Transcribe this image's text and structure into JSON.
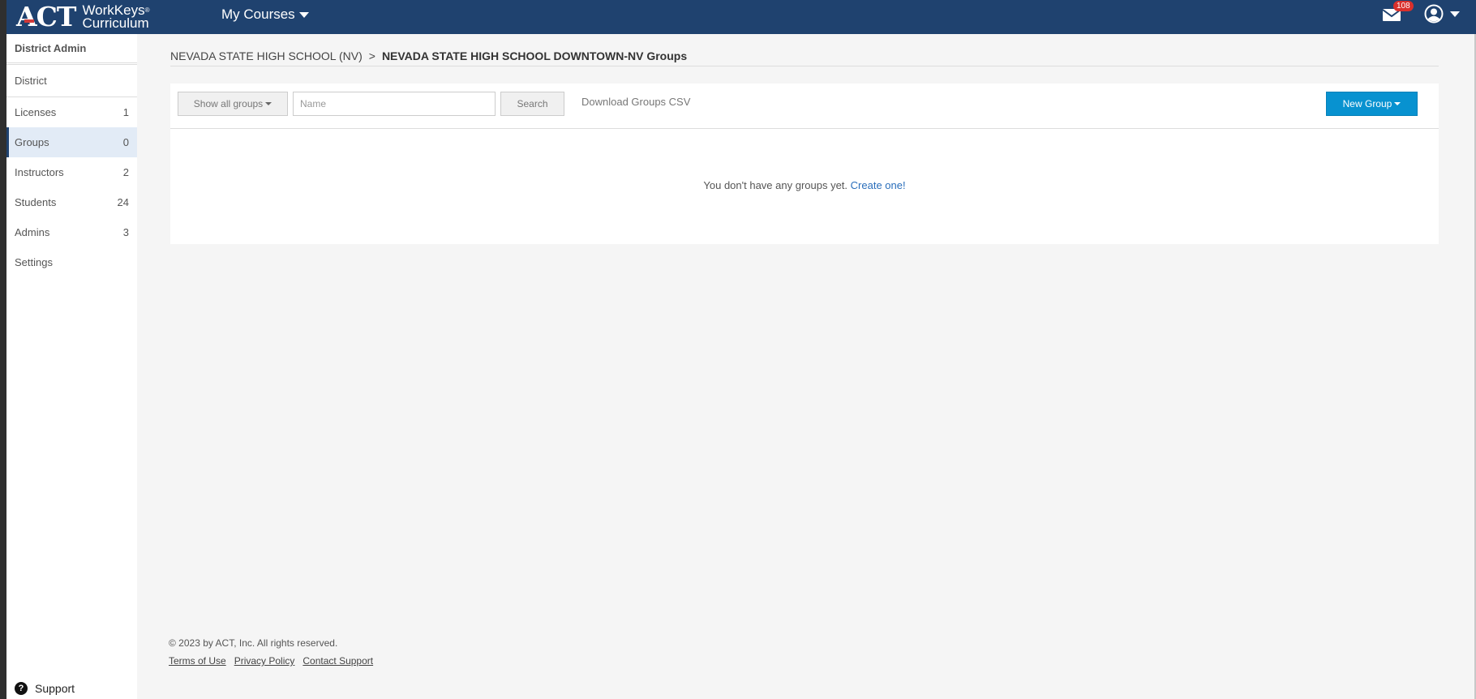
{
  "header": {
    "logo": {
      "brand": "ACT",
      "product_line1": "WorkKeys",
      "product_line2": "Curriculum"
    },
    "menu_label": "My Courses",
    "mail_badge": "108",
    "colors": {
      "nav_bg": "#1f426f",
      "badge": "#d9302c"
    }
  },
  "sidebar": {
    "heading": "District Admin",
    "items": [
      {
        "label": "District",
        "count": ""
      },
      {
        "label": "Licenses",
        "count": "1"
      },
      {
        "label": "Groups",
        "count": "0"
      },
      {
        "label": "Instructors",
        "count": "2"
      },
      {
        "label": "Students",
        "count": "24"
      },
      {
        "label": "Admins",
        "count": "3"
      },
      {
        "label": "Settings",
        "count": ""
      }
    ],
    "active_item": "Groups",
    "support_label": "Support"
  },
  "breadcrumb": {
    "parent": "NEVADA STATE HIGH SCHOOL (NV)",
    "separator": ">",
    "current": "NEVADA STATE HIGH SCHOOL DOWNTOWN-NV Groups"
  },
  "toolbar": {
    "filter_label": "Show all groups",
    "search_placeholder": "Name",
    "search_value": "",
    "search_label": "Search",
    "download_label": "Download Groups CSV",
    "new_group_label": "New Group",
    "accent": "#0892d0"
  },
  "empty_state": {
    "message": "You don't have any groups yet.",
    "link": "Create one!"
  },
  "footer": {
    "copyright": "© 2023 by ACT, Inc. All rights reserved.",
    "links": [
      "Terms of Use",
      "Privacy Policy",
      "Contact Support"
    ]
  }
}
